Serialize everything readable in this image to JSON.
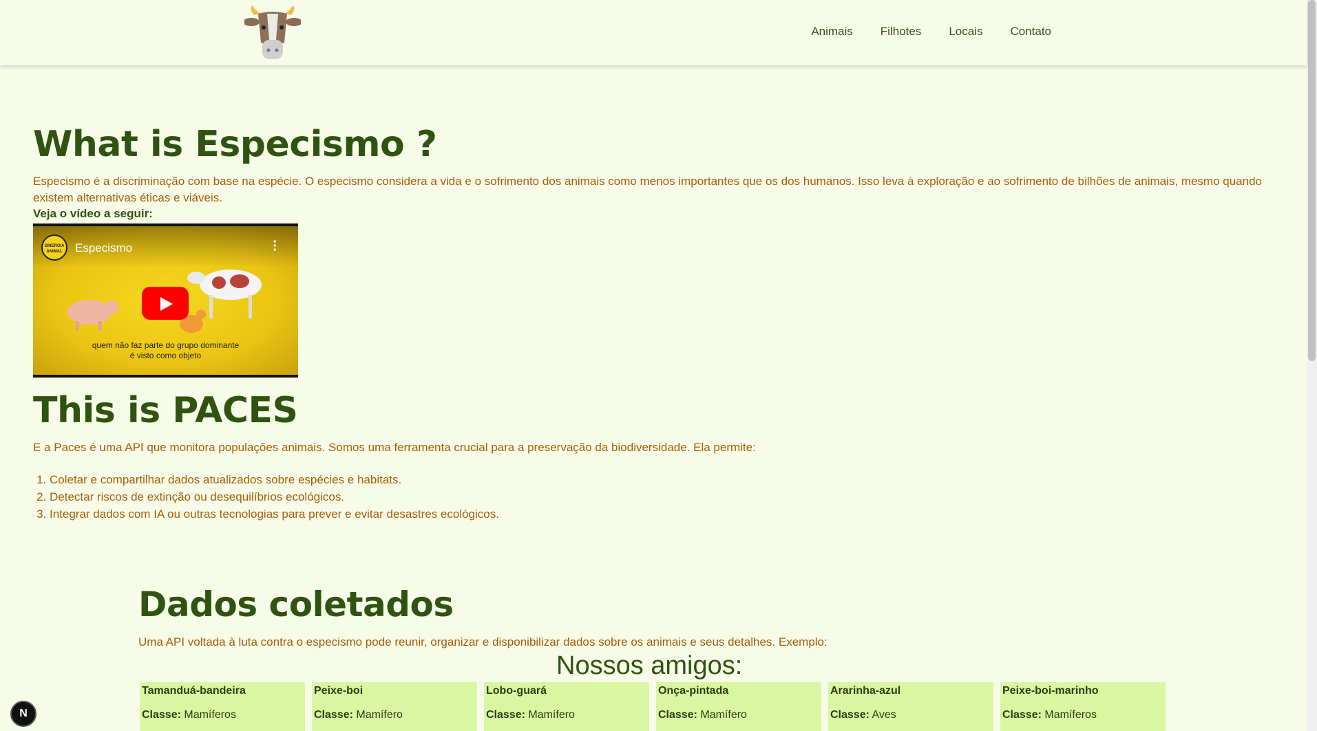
{
  "nav": {
    "links": [
      "Animais",
      "Filhotes",
      "Locais",
      "Contato"
    ]
  },
  "intro": {
    "title": "What is Especismo ?",
    "text": "Especismo é a discriminação com base na espécie. O especismo considera a vida e o sofrimento dos animais como menos importantes que os dos humanos. Isso leva à exploração e ao sofrimento de bilhões de animais, mesmo quando existem alternativas éticas e viáveis.",
    "video_label": "Veja o vídeo a seguir:"
  },
  "video": {
    "title": "Especismo",
    "channel": "SINERGIA ANIMAL",
    "caption_line1": "quem não faz parte do grupo dominante",
    "caption_line2": "é visto como objeto"
  },
  "paces": {
    "title": "This is PACES",
    "text": "E a Paces é uma API que monitora populações animais. Somos uma ferramenta crucial para a preservação da biodiversidade. Ela permite:",
    "items": [
      "Coletar e compartilhar dados atualizados sobre espécies e habitats.",
      "Detectar riscos de extinção ou desequilíbrios ecológicos.",
      "Integrar dados com IA ou outras tecnologias para prever e evitar desastres ecológicos."
    ]
  },
  "dados": {
    "title": "Dados coletados",
    "text": "Uma API voltada à luta contra o especismo pode reunir, organizar e disponibilizar dados sobre os animais e seus detalhes. Exemplo:",
    "subtitle": "Nossos amigos:",
    "class_label": "Classe:",
    "cards": [
      {
        "name": "Tamanduá-bandeira",
        "classe": "Mamíferos"
      },
      {
        "name": "Peixe-boi",
        "classe": "Mamífero"
      },
      {
        "name": "Lobo-guará",
        "classe": "Mamífero"
      },
      {
        "name": "Onça-pintada",
        "classe": "Mamífero"
      },
      {
        "name": "Ararinha-azul",
        "classe": "Aves"
      },
      {
        "name": "Peixe-boi-marinho",
        "classe": "Mamíferos"
      }
    ]
  },
  "badge": "N"
}
